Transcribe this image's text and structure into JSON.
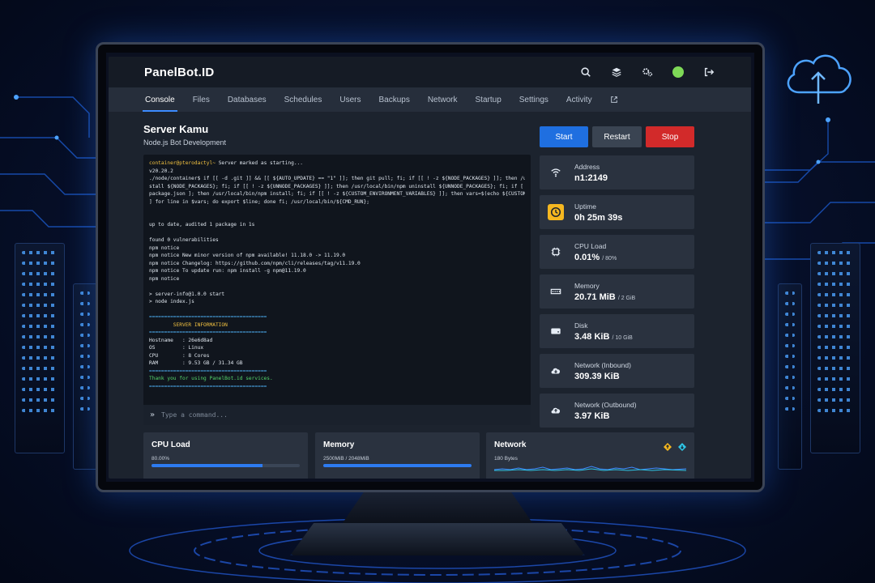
{
  "app": {
    "brand": "PanelBot.ID"
  },
  "tabs": [
    {
      "label": "Console",
      "active": true
    },
    {
      "label": "Files"
    },
    {
      "label": "Databases"
    },
    {
      "label": "Schedules"
    },
    {
      "label": "Users"
    },
    {
      "label": "Backups"
    },
    {
      "label": "Network"
    },
    {
      "label": "Startup"
    },
    {
      "label": "Settings"
    },
    {
      "label": "Activity"
    }
  ],
  "server": {
    "name": "Server Kamu",
    "description": "Node.js Bot Development"
  },
  "power": {
    "start": "Start",
    "restart": "Restart",
    "stop": "Stop"
  },
  "console": {
    "lines": [
      {
        "prompt": "container@pterodactyl~",
        "text": " Server marked as starting..."
      },
      {
        "text": "v20.20.2"
      },
      {
        "text": "./node/container$ if [[ -d .git ]] && [[ ${AUTO_UPDATE} == \"1\" ]]; then git pull; fi; if [[ ! -z ${NODE_PACKAGES} ]]; then /usr/local/bin/npm in"
      },
      {
        "text": "stall ${NODE_PACKAGES}; fi; if [[ ! -z ${UNNODE_PACKAGES} ]]; then /usr/local/bin/npm uninstall ${UNNODE_PACKAGES}; fi; if [ -f /home/container/"
      },
      {
        "text": "package.json ]; then /usr/local/bin/npm install; fi; if [[ ! -z ${CUSTOM_ENVIRONMENT_VARIABLES} ]]; then vars=$(echo ${CUSTOM_ENVIRONMENT_VARIABLES} | tr"
      },
      {
        "text": "] for line in $vars; do export $line; done fi; /usr/local/bin/${CMD_RUN};"
      },
      {
        "text": ""
      },
      {
        "text": ""
      },
      {
        "text": "up to date, audited 1 package in 1s"
      },
      {
        "text": ""
      },
      {
        "text": "found 0 vulnerabilities"
      },
      {
        "text": "npm notice"
      },
      {
        "text": "npm notice New minor version of npm available! 11.18.0 -> 11.19.0"
      },
      {
        "text": "npm notice Changelog: https://github.com/npm/cli/releases/tag/v11.19.0"
      },
      {
        "text": "npm notice To update run: npm install -g npm@11.19.0"
      },
      {
        "text": "npm notice"
      },
      {
        "text": ""
      },
      {
        "text": "> server-info@1.0.0 start"
      },
      {
        "text": "> node index.js"
      },
      {
        "text": ""
      },
      {
        "text": "=======================================",
        "style": "cyan"
      },
      {
        "text": "        SERVER INFORMATION",
        "style": "yellow"
      },
      {
        "text": "=======================================",
        "style": "cyan"
      },
      {
        "text": "Hostname   : 26e6d8ad"
      },
      {
        "text": "OS         : Linux"
      },
      {
        "text": "CPU        : 8 Cores"
      },
      {
        "text": "RAM        : 9.53 GB / 31.34 GB"
      },
      {
        "text": "=======================================",
        "style": "cyan"
      },
      {
        "text": "Thank you for using PanelBot.id services.",
        "style": "green"
      },
      {
        "text": "=======================================",
        "style": "cyan"
      }
    ],
    "input_placeholder": "Type a command..."
  },
  "stats": [
    {
      "label": "Address",
      "value": "n1:2149",
      "unit": "",
      "icon": "wifi-icon"
    },
    {
      "label": "Uptime",
      "value": "0h 25m 39s",
      "unit": "",
      "icon": "clock-icon"
    },
    {
      "label": "CPU Load",
      "value": "0.01%",
      "unit": "/ 80%",
      "icon": "cpu-icon"
    },
    {
      "label": "Memory",
      "value": "20.71 MiB",
      "unit": "/ 2 GiB",
      "icon": "memory-icon"
    },
    {
      "label": "Disk",
      "value": "3.48 KiB",
      "unit": "/ 10 GiB",
      "icon": "disk-icon"
    },
    {
      "label": "Network (Inbound)",
      "value": "309.39 KiB",
      "unit": "",
      "icon": "cloud-download-icon"
    },
    {
      "label": "Network (Outbound)",
      "value": "3.97 KiB",
      "unit": "",
      "icon": "cloud-upload-icon"
    }
  ],
  "graphs": {
    "cpu": {
      "title": "CPU Load",
      "sub": "80.00%",
      "fill": 0.75
    },
    "memory": {
      "title": "Memory",
      "sub": "2500MiB / 2048MiB",
      "fill": 1.0
    },
    "network": {
      "title": "Network",
      "sub": "180 Bytes"
    }
  },
  "colors": {
    "accent": "#3d8bff",
    "start": "#1f6fe0",
    "stop": "#d22a2a",
    "restart": "#3a4452"
  }
}
